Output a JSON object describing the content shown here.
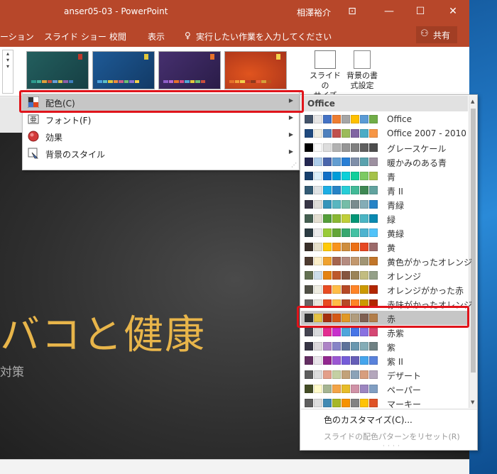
{
  "window": {
    "title": "anser05-03  -  PowerPoint",
    "user": "相澤裕介"
  },
  "ribbon": {
    "tabs": [
      "ーション",
      "スライド ショー",
      "校閲",
      "表示"
    ],
    "tell_me": "実行したい作業を入力してください",
    "share": "共有",
    "slide_size_label": "スライドの\nサイズ",
    "bg_format_label": "背景の書\n式設定"
  },
  "variants": [
    {
      "bg": "#1e5c5a",
      "accent": "#c0392b",
      "bar": [
        "#2c9b8e",
        "#45b39d",
        "#e0a03a",
        "#c94f3d",
        "#6a9fd8",
        "#d4c24b",
        "#8e5fa8",
        "#3f7fbf"
      ]
    },
    {
      "bg": "#1b4f8a",
      "accent": "#e2c83a",
      "bar": [
        "#4aa3df",
        "#5dc0c7",
        "#e2c83a",
        "#f08c3a",
        "#c95d8a",
        "#6fbf73",
        "#8a6fd4",
        "#f2d14b"
      ]
    },
    {
      "bg": "#3d2a6a",
      "accent": "#e6702a",
      "bar": [
        "#8e5fc8",
        "#b86ad4",
        "#e6702a",
        "#d24f8a",
        "#4fa8d8",
        "#e2c83a",
        "#6fbf73",
        "#c94f3d"
      ]
    },
    {
      "bg": "#c2431c",
      "accent": "#f2d14b",
      "bar": [
        "#e6702a",
        "#f29f3a",
        "#f2d14b",
        "#c0392b",
        "#8e3a1c",
        "#e85d3a",
        "#d4a03a",
        "#b8541c"
      ]
    }
  ],
  "design_menu": {
    "items": [
      {
        "label": "配色(C)",
        "icon": "color-scheme-icon"
      },
      {
        "label": "フォント(F)",
        "icon": "font-icon"
      },
      {
        "label": "効果",
        "icon": "effects-icon"
      },
      {
        "label": "背景のスタイル",
        "icon": "background-style-icon"
      }
    ]
  },
  "color_panel": {
    "header": "Office",
    "schemes": [
      {
        "name": "Office",
        "colors": [
          "#44546a",
          "#e7e6e6",
          "#4472c4",
          "#ed7d31",
          "#a5a5a5",
          "#ffc000",
          "#5b9bd5",
          "#70ad47"
        ]
      },
      {
        "name": "Office 2007 - 2010",
        "colors": [
          "#1f497d",
          "#eeece1",
          "#4f81bd",
          "#c0504d",
          "#9bbb59",
          "#8064a2",
          "#4bacc6",
          "#f79646"
        ]
      },
      {
        "name": "グレースケール",
        "colors": [
          "#000000",
          "#f8f8f8",
          "#dddddd",
          "#b2b2b2",
          "#969696",
          "#808080",
          "#5f5f5f",
          "#4d4d4d"
        ]
      },
      {
        "name": "暖かみのある青",
        "colors": [
          "#242852",
          "#acccea",
          "#4a66ac",
          "#629dd1",
          "#297fd5",
          "#7f8fa9",
          "#5aa2ae",
          "#9d90a0"
        ]
      },
      {
        "name": "青",
        "colors": [
          "#17406d",
          "#dbeff9",
          "#0f6fc6",
          "#009dd9",
          "#0bd0d9",
          "#10cf9b",
          "#7cca62",
          "#a5c249"
        ]
      },
      {
        "name": "青 II",
        "colors": [
          "#335b74",
          "#dfe3e5",
          "#1cade4",
          "#2683c6",
          "#27ced7",
          "#42ba97",
          "#3e8853",
          "#62a39f"
        ]
      },
      {
        "name": "青緑",
        "colors": [
          "#373545",
          "#dedcd8",
          "#3494ba",
          "#58b6c0",
          "#75bda7",
          "#7a8c8e",
          "#84acb6",
          "#2683c6"
        ]
      },
      {
        "name": "緑",
        "colors": [
          "#455f51",
          "#e3ded1",
          "#549e39",
          "#8ab833",
          "#c0cf3a",
          "#029676",
          "#4ab5c4",
          "#0989b1"
        ]
      },
      {
        "name": "黄緑",
        "colors": [
          "#2c3c43",
          "#ebebeb",
          "#99cb38",
          "#63a537",
          "#37a76f",
          "#44c1a3",
          "#4eb3cf",
          "#51c3f9"
        ]
      },
      {
        "name": "黄",
        "colors": [
          "#39302a",
          "#e5dec9",
          "#ffca08",
          "#f8931d",
          "#ce8d3e",
          "#ec7016",
          "#e64823",
          "#9c6a6a"
        ]
      },
      {
        "name": "黄色がかったオレンジ",
        "colors": [
          "#4e3b30",
          "#fbeec9",
          "#f0a22e",
          "#a5644e",
          "#b58b80",
          "#c3986d",
          "#a19574",
          "#c17529"
        ]
      },
      {
        "name": "オレンジ",
        "colors": [
          "#637052",
          "#ccddea",
          "#e48312",
          "#bd582c",
          "#865640",
          "#9b8357",
          "#c2bc80",
          "#94a088"
        ]
      },
      {
        "name": "オレンジがかった赤",
        "colors": [
          "#505046",
          "#eeece1",
          "#e84c22",
          "#ffbd47",
          "#b64926",
          "#ff8427",
          "#cc9900",
          "#b22600"
        ]
      },
      {
        "name": "赤味がかったオレンジ",
        "colors": [
          "#696464",
          "#e9e5dc",
          "#e84c22",
          "#ffbd47",
          "#b64926",
          "#ff8427",
          "#cc9900",
          "#b22600"
        ]
      },
      {
        "name": "赤",
        "colors": [
          "#323232",
          "#e5c243",
          "#a5300f",
          "#d55816",
          "#e19825",
          "#b19c7d",
          "#7f5f52",
          "#b27d49"
        ]
      },
      {
        "name": "赤紫",
        "colors": [
          "#454551",
          "#d8d9dc",
          "#e32d91",
          "#c830cc",
          "#4ea6dc",
          "#4775e7",
          "#8971e1",
          "#d54773"
        ]
      },
      {
        "name": "紫",
        "colors": [
          "#373545",
          "#dcd8dc",
          "#ad84c6",
          "#8784c7",
          "#5d739a",
          "#6997af",
          "#84acb6",
          "#6f8183"
        ]
      },
      {
        "name": "紫 II",
        "colors": [
          "#632e62",
          "#eae5eb",
          "#92278f",
          "#9b57d3",
          "#755dd9",
          "#665eb8",
          "#45a5ed",
          "#5982db"
        ]
      },
      {
        "name": "デザート",
        "colors": [
          "#5e5e5e",
          "#dddddd",
          "#e39f8a",
          "#c4d0a3",
          "#c2a279",
          "#8ba3b8",
          "#d79e7e",
          "#b4a7bc"
        ]
      },
      {
        "name": "ペーパー",
        "colors": [
          "#444d26",
          "#fefac9",
          "#a5b592",
          "#f3a447",
          "#e7bc29",
          "#d092a7",
          "#9c85c0",
          "#809ec2"
        ]
      },
      {
        "name": "マーキー",
        "colors": [
          "#5e5e5e",
          "#dddddd",
          "#418ab3",
          "#a6b727",
          "#f69200",
          "#838383",
          "#fec306",
          "#df5327"
        ]
      }
    ],
    "selected_index": 14,
    "customize_label": "色のカスタマイズ(C)...",
    "reset_label": "スライドの配色パターンをリセット(R)"
  },
  "slide": {
    "title": "バコと健康",
    "subtitle": "対策"
  }
}
